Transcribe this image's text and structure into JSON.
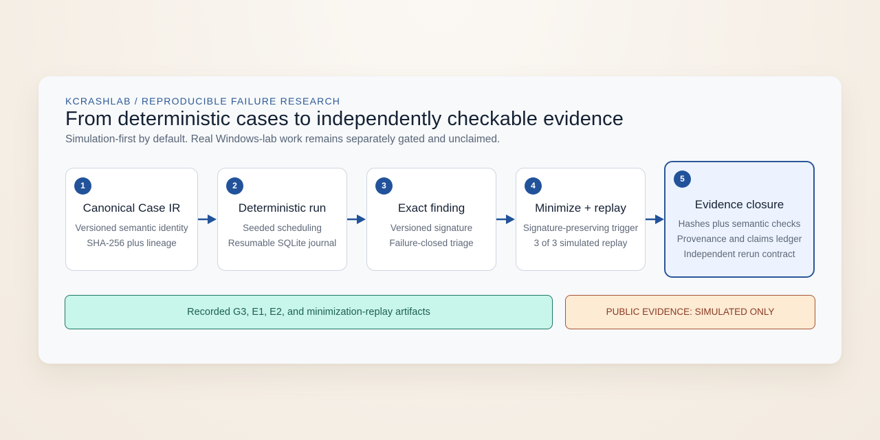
{
  "header": {
    "eyebrow": "KCRASHLAB / REPRODUCIBLE FAILURE RESEARCH",
    "title": "From deterministic cases to independently checkable evidence",
    "subtitle": "Simulation-first by default. Real Windows-lab work remains separately gated and unclaimed."
  },
  "steps": [
    {
      "number": "1",
      "title": "Canonical Case IR",
      "lines": [
        "Versioned semantic identity",
        "SHA-256 plus lineage"
      ]
    },
    {
      "number": "2",
      "title": "Deterministic run",
      "lines": [
        "Seeded scheduling",
        "Resumable SQLite journal"
      ]
    },
    {
      "number": "3",
      "title": "Exact finding",
      "lines": [
        "Versioned signature",
        "Failure-closed triage"
      ]
    },
    {
      "number": "4",
      "title": "Minimize + replay",
      "lines": [
        "Signature-preserving trigger",
        "3 of 3 simulated replay"
      ]
    },
    {
      "number": "5",
      "title": "Evidence closure",
      "lines": [
        "Hashes plus semantic checks",
        "Provenance and claims ledger",
        "Independent rerun contract"
      ]
    }
  ],
  "banners": {
    "recorded": "Recorded G3, E1, E2, and minimization-replay artifacts",
    "public": "PUBLIC EVIDENCE: SIMULATED ONLY"
  },
  "colors": {
    "accent": "#22529a",
    "recorded_bg": "#c8f6ea",
    "public_bg": "#fdebd4"
  }
}
